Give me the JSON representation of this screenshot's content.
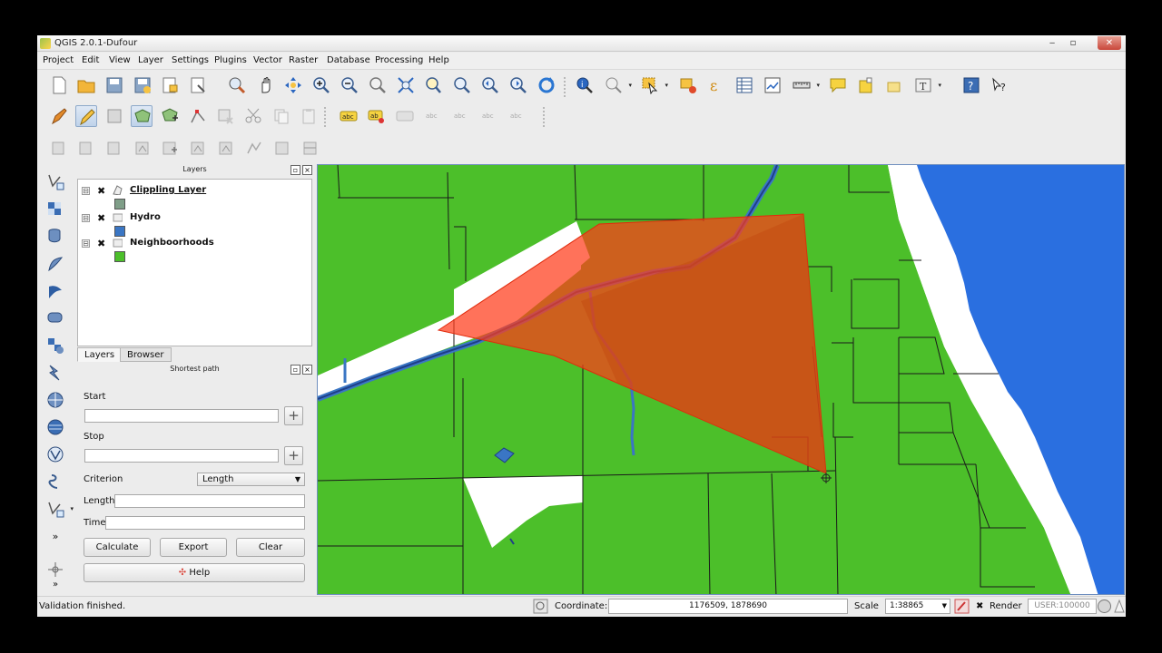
{
  "window": {
    "title": "QGIS 2.0.1-Dufour",
    "controls": [
      "‒",
      "▫",
      "✕"
    ]
  },
  "menu": [
    "Project",
    "Edit",
    "View",
    "Layer",
    "Settings",
    "Plugins",
    "Vector",
    "Raster",
    "Database",
    "Processing",
    "Help"
  ],
  "layers_panel": {
    "title": "Layers",
    "layers": [
      {
        "name": "Clippling Layer",
        "checked": "✖",
        "swatch": "#7f9e88"
      },
      {
        "name": "Hydro",
        "checked": "✖",
        "swatch": "#3a76c4"
      },
      {
        "name": "Neighboorhoods",
        "checked": "✖",
        "swatch": "#4cbf2a"
      }
    ],
    "expander": "⊟"
  },
  "tabs": [
    "Layers",
    "Browser"
  ],
  "shortest_path": {
    "title": "Shortest path",
    "start_label": "Start",
    "start_value": "",
    "stop_label": "Stop",
    "stop_value": "",
    "criterion_label": "Criterion",
    "criterion_value": "Length",
    "length_label": "Length",
    "length_value": "",
    "time_label": "Time",
    "time_value": "",
    "calculate": "Calculate",
    "export": "Export",
    "clear": "Clear",
    "help": "Help",
    "pick_glyph": "+"
  },
  "status": {
    "message": "Validation finished.",
    "coordinate_label": "Coordinate:",
    "coordinate_value": "1176509, 1878690",
    "scale_label": "Scale",
    "scale_value": "1:38865",
    "render_label": "Render",
    "render_checked": "✖",
    "crs": "USER:100000"
  },
  "colors": {
    "land": "#4cbf2a",
    "water": "#2a6fe0",
    "hydro_line": "#3a76c4",
    "clip_fill": "#ff3b1a",
    "beach": "#ffffff"
  }
}
